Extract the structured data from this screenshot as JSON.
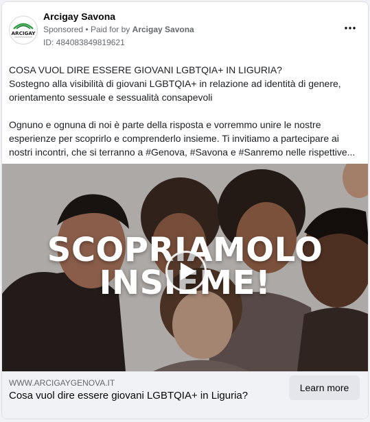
{
  "advertiser": {
    "name": "Arcigay Savona",
    "avatar_text": "ARCIGAY",
    "sponsored_label": "Sponsored",
    "separator": "•",
    "paid_for_prefix": "Paid for by",
    "paid_for_name": "Arcigay Savona",
    "ad_id": "ID: 484083849819621"
  },
  "menu": {
    "icon": "more-horizontal-icon"
  },
  "body": {
    "line1": "COSA VUOL DIRE ESSERE GIOVANI LGBTQIA+ IN LIGURIA?",
    "line2": "Sostegno alla visibilità di giovani LGBTQIA+ in relazione ad identità di genere, orientamento sessuale e sessualità consapevoli",
    "line3": "Ognuno e ognuna di noi è parte della risposta e vorremmo unire le nostre esperienze per scoprirlo e comprenderlo insieme. Ti invitiamo a partecipare ai nostri incontri, che si terranno a #Genova, #Savona e #Sanremo nelle rispettive..."
  },
  "media": {
    "overlay_line1": "SCOPRIAMOLO",
    "overlay_line2": "INSIEME!",
    "play_icon": "play-icon"
  },
  "footer": {
    "domain": "WWW.ARCIGAYGENOVA.IT",
    "headline": "Cosa vuol dire essere giovani LGBTQIA+ in Liguria?",
    "cta_label": "Learn more"
  },
  "colors": {
    "card_bg": "#ffffff",
    "page_bg": "#f0f2f5",
    "secondary_text": "#65676b",
    "cta_bg": "#e4e6eb",
    "brand_green": "#2e9e3e"
  }
}
